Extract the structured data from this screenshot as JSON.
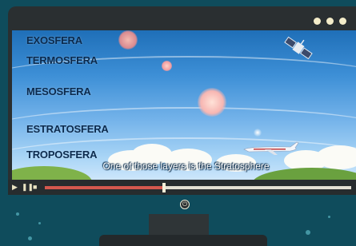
{
  "player": {
    "layers": [
      "EXOSFERA",
      "TERMOSFERA",
      "MESOSFERA",
      "ESTRATOSFERA",
      "TROPOSFERA"
    ],
    "subtitle": "One of those layers is the Stratosphere",
    "progress": 0.39,
    "accent_color": "#d4584e",
    "layer_text_color": "#0b2a4d"
  },
  "controls": {
    "play_icon": "play-icon",
    "pause_icon": "pause-icon",
    "stop_icon": "stop-icon",
    "power_icon": "power-icon"
  }
}
